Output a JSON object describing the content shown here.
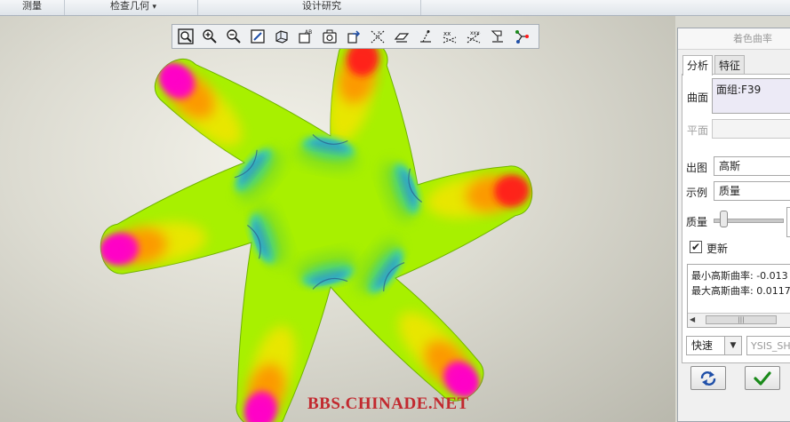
{
  "ribbon": {
    "groups": [
      "测量",
      "检查几何",
      "设计研究"
    ],
    "dropdown_marker": "▾"
  },
  "toolbar": {
    "icons": [
      "zoom-fit-icon",
      "zoom-in-icon",
      "zoom-out-icon",
      "repaint-icon",
      "display-style-icon",
      "saved-views-icon",
      "named-view-icon",
      "spin-center-icon",
      "datum-planes-icon",
      "datum-axes-icon",
      "datum-points-icon",
      "coordinate-systems-icon",
      "annotation-display-icon",
      "annotation-icon",
      "network-icon"
    ]
  },
  "viewport": {
    "watermark": "BBS.CHINADE.NET"
  },
  "dialog": {
    "title": "着色曲率",
    "tabs": [
      "分析",
      "特征"
    ],
    "surface_label": "曲面",
    "surface_value": "面组:F39",
    "plane_label": "平面",
    "output_label": "出图",
    "output_value": "高斯",
    "example_label": "示例",
    "example_value": "质量",
    "quality_label": "质量",
    "quality_level": 0.1,
    "update_label": "更新",
    "update_checked": true,
    "check_mark": "✔",
    "results": [
      "最小高斯曲率: -0.013",
      "最大高斯曲率: 0.0117"
    ],
    "scroll_left": "◀",
    "scroll_thumb": "|||",
    "mode_value": "快速",
    "name_value": "YSIS_SH",
    "dropdown_arrow": "▼"
  },
  "colors": {
    "surface_green": "#a8f000",
    "high_red": "#ff1a1a",
    "peak_magenta": "#ff00c8",
    "low_blue": "#1e8cff",
    "ok_green": "#1a8a1a",
    "refresh_blue": "#1f4fa8"
  }
}
